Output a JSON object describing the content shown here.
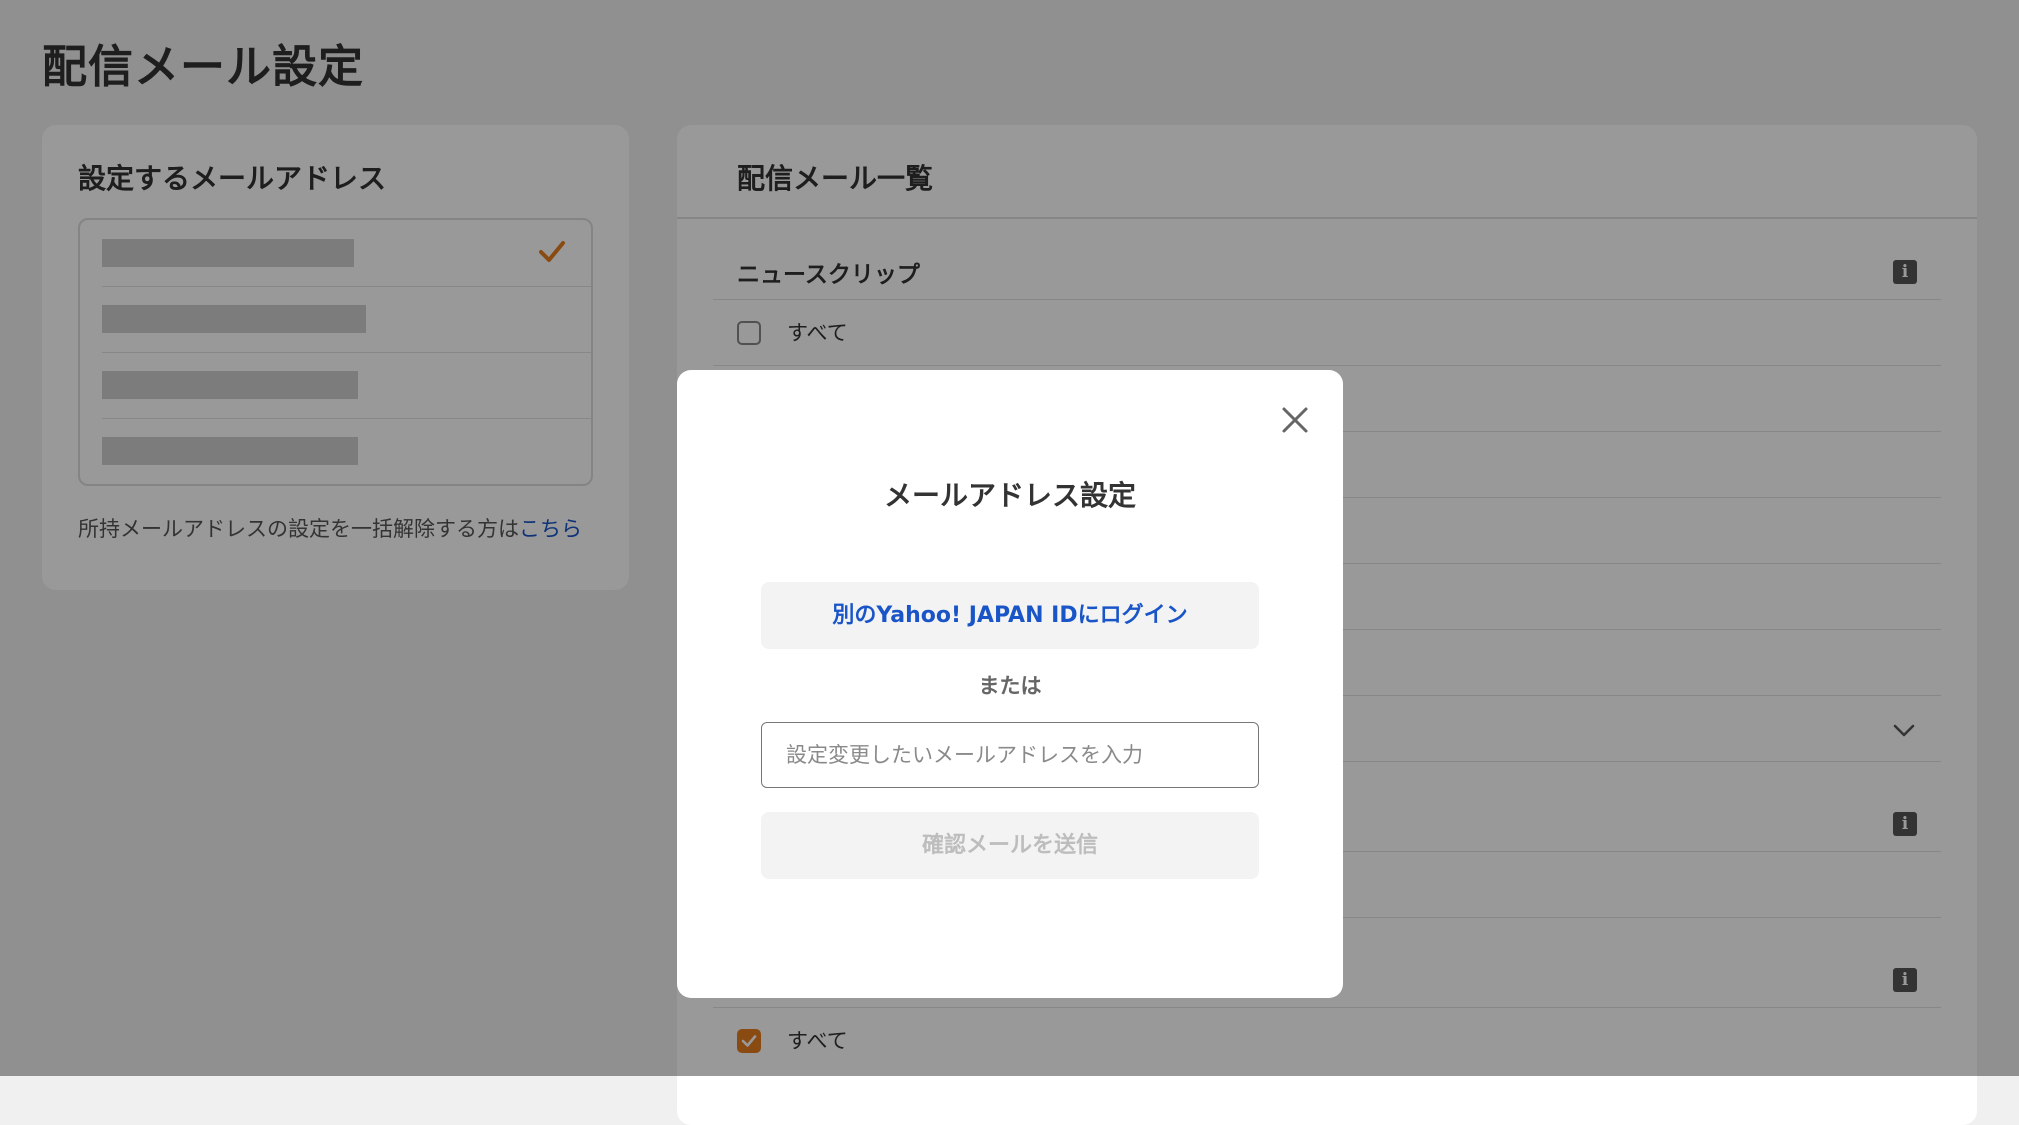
{
  "page": {
    "title": "配信メール設定"
  },
  "left_card": {
    "title": "設定するメールアドレス",
    "unlink_text": "所持メールアドレスの設定を一括解除する方は",
    "unlink_link": "こちら"
  },
  "right_card": {
    "title": "配信メール一覧",
    "sections": [
      {
        "title": "ニュースクリップ",
        "all_label": "すべて",
        "all_checked": false
      },
      {
        "all_label": "すべて",
        "all_checked": true
      }
    ]
  },
  "modal": {
    "title": "メールアドレス設定",
    "login_button": "別のYahoo! JAPAN IDにログイン",
    "or_text": "または",
    "email_placeholder": "設定変更したいメールアドレスを入力",
    "send_button": "確認メールを送信"
  },
  "colors": {
    "accent": "#e47d1e",
    "link": "#1a55c8"
  },
  "icons": {
    "close": "close-icon",
    "check": "check-icon",
    "info": "info-icon",
    "chevron": "chevron-down-icon"
  }
}
